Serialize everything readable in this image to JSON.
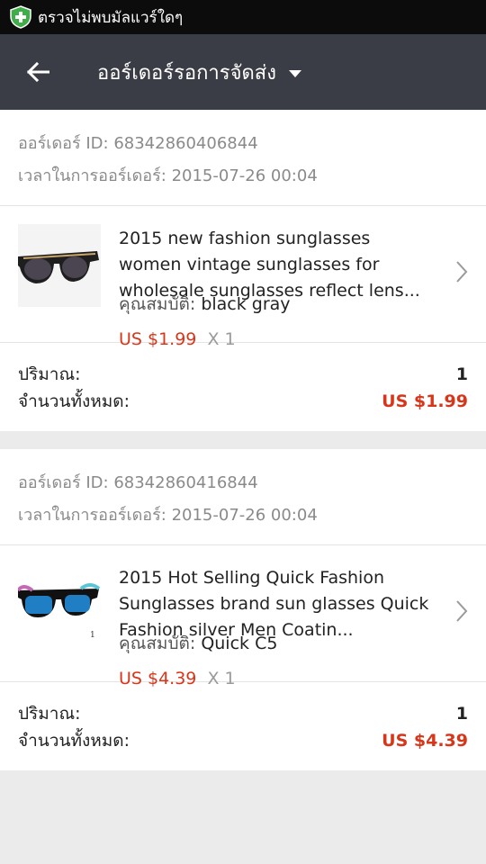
{
  "status_bar": {
    "notification_text": "ตรวจไม่พบมัลแวร์ใดๆ",
    "icon": "shield-plus-icon",
    "accent": "#3fae49"
  },
  "app_bar": {
    "back_icon": "arrow-left-icon",
    "title": "ออร์เดอร์รอการจัดส่ง",
    "dropdown_icon": "caret-down-icon",
    "background": "#3a3d45"
  },
  "orders": [
    {
      "id_label": "ออร์เดอร์ ID:",
      "id_value": "68342860406844",
      "time_label": "เวลาในการออร์เดอร์:",
      "time_value": "2015-07-26 00:04",
      "product": {
        "title": "2015 new fashion sunglasses women vintage sunglasses for wholesale sunglasses reflect lens...",
        "property_label": "คุณสมบัติ:",
        "property_value": "black gray",
        "price": "US $1.99",
        "quantity": "X 1",
        "thumbnail_icon": "sunglasses-thumbnail"
      },
      "qty_label": "ปริมาณ:",
      "qty_value": "1",
      "total_label": "จำนวนทั้งหมด:",
      "total_value": "US $1.99"
    },
    {
      "id_label": "ออร์เดอร์ ID:",
      "id_value": "68342860416844",
      "time_label": "เวลาในการออร์เดอร์:",
      "time_value": "2015-07-26 00:04",
      "product": {
        "title": "2015 Hot Selling Quick Fashion Sunglasses brand sun glasses Quick Fashion silver Men Coatin...",
        "property_label": "คุณสมบัติ:",
        "property_value": "Quick C5",
        "price": "US $4.39",
        "quantity": "X 1",
        "thumbnail_icon": "sunglasses-thumbnail",
        "thumbnail_caption": "1"
      },
      "qty_label": "ปริมาณ:",
      "qty_value": "1",
      "total_label": "จำนวนทั้งหมด:",
      "total_value": "US $4.39"
    }
  ],
  "colors": {
    "price": "#d7361a",
    "muted": "#8a8a8a",
    "divider": "#e4e4e4"
  }
}
